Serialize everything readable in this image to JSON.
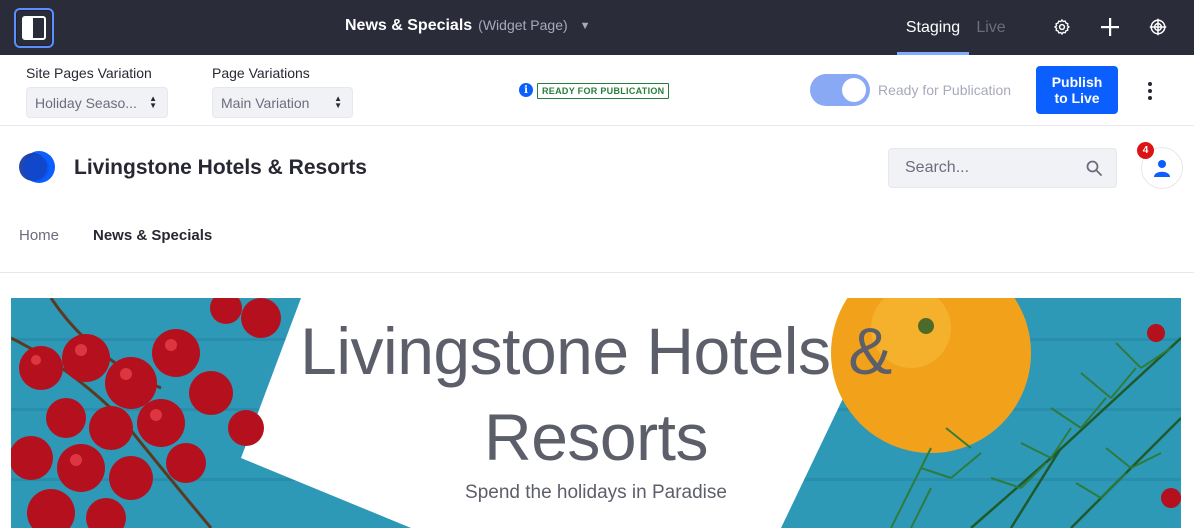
{
  "topbar": {
    "title": "News & Specials",
    "page_type": "(Widget Page)",
    "tabs": [
      {
        "label": "Staging",
        "active": true
      },
      {
        "label": "Live",
        "active": false
      }
    ],
    "icons": [
      "product-menu-icon",
      "gear-icon",
      "plus-icon",
      "simulation-icon"
    ]
  },
  "staging": {
    "site_pages_variation": {
      "label": "Site Pages Variation",
      "value": "Holiday Seaso..."
    },
    "page_variations": {
      "label": "Page Variations",
      "value": "Main Variation"
    },
    "status_badge": "READY FOR PUBLICATION",
    "toggle": {
      "label": "Ready for Publication",
      "on": true
    },
    "publish_button": "Publish\nto Live"
  },
  "site": {
    "name": "Livingstone Hotels & Resorts",
    "search_placeholder": "Search...",
    "notification_count": "4",
    "nav": [
      {
        "label": "Home",
        "active": false
      },
      {
        "label": "News & Specials",
        "active": true
      }
    ]
  },
  "hero": {
    "title": "Livingstone Hotels & Resorts",
    "subtitle": "Spend the holidays in Paradise"
  },
  "colors": {
    "topbar_bg": "#2b2c3a",
    "primary": "#0b5fff",
    "success": "#287d3c",
    "danger": "#da1414",
    "hero_bg": "#2e97b6"
  }
}
